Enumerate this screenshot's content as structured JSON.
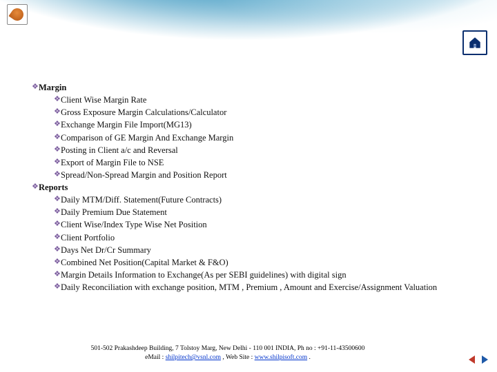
{
  "sections": [
    {
      "title": "Margin",
      "items": [
        "Client Wise Margin Rate",
        "Gross Exposure Margin Calculations/Calculator",
        "Exchange Margin File Import(MG13)",
        "Comparison of GE Margin And Exchange Margin",
        "Posting in Client a/c and Reversal",
        "Export of Margin File to NSE",
        "Spread/Non-Spread Margin and Position Report"
      ]
    },
    {
      "title": "Reports",
      "items": [
        "Daily MTM/Diff. Statement(Future Contracts)",
        "Daily Premium Due Statement",
        "Client Wise/Index Type Wise Net Position",
        "Client Portfolio",
        "Days Net Dr/Cr Summary",
        "Combined Net Position(Capital Market & F&O)",
        "Margin Details Information to Exchange(As per SEBI guidelines) with digital sign",
        "Daily Reconciliation with exchange position, MTM , Premium , Amount and Exercise/Assignment Valuation"
      ]
    }
  ],
  "footer": {
    "line1": "501-502 Prakashdeep Building, 7 Tolstoy Marg, New Delhi - 110 001 INDIA, Ph no : +91-11-43500600",
    "email_label": "eMail : ",
    "email": "shilpitech@vsnl.com",
    "sep": " , ",
    "website_label": "Web Site : ",
    "website": "www.shilpisoft.com",
    "tail": " ."
  }
}
